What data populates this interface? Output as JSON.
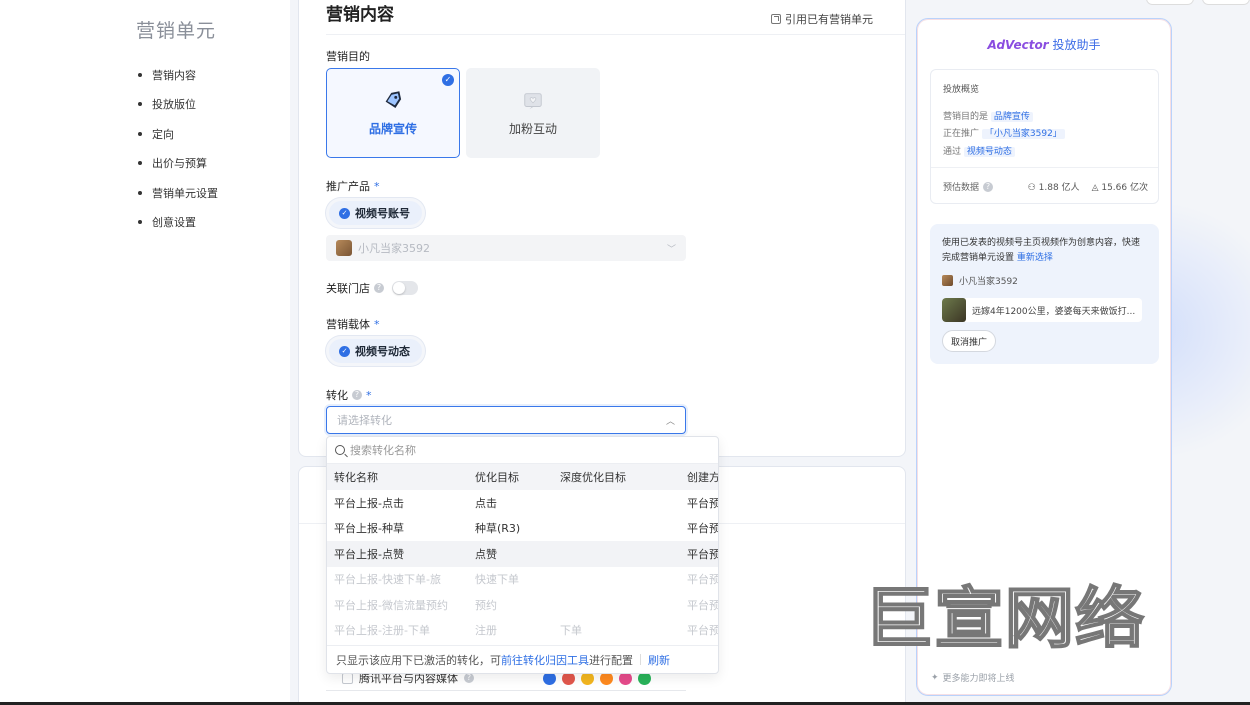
{
  "nav": {
    "title": "营销单元",
    "items": [
      "营销内容",
      "投放版位",
      "定向",
      "出价与预算",
      "营销单元设置",
      "创意设置"
    ]
  },
  "main": {
    "section_title": "营销内容",
    "quote_link": "引用已有营销单元",
    "goal_label": "营销目的",
    "goals": [
      {
        "label": "品牌宣传",
        "icon": "tag-icon",
        "selected": true
      },
      {
        "label": "加粉互动",
        "icon": "message-heart-icon",
        "selected": false
      }
    ],
    "product_label": "推广产品",
    "product_pill": "视频号账号",
    "account_select": "小凡当家3592",
    "store_label": "关联门店",
    "carrier_label": "营销载体",
    "carrier_pill": "视频号动态",
    "conversion_label": "转化",
    "conversion_placeholder": "请选择转化",
    "required_mark": "*"
  },
  "dropdown": {
    "search_placeholder": "搜索转化名称",
    "columns": [
      "转化名称",
      "优化目标",
      "深度优化目标",
      "创建方"
    ],
    "rows": [
      {
        "name": "平台上报-点击",
        "goal": "点击",
        "deep": "",
        "creator": "平台预",
        "state": "normal"
      },
      {
        "name": "平台上报-种草",
        "goal": "种草(R3)",
        "deep": "",
        "creator": "平台预",
        "state": "normal"
      },
      {
        "name": "平台上报-点赞",
        "goal": "点赞",
        "deep": "",
        "creator": "平台预",
        "state": "hover"
      },
      {
        "name": "平台上报-快速下单-旅",
        "goal": "快速下单",
        "deep": "",
        "creator": "平台预",
        "state": "disabled"
      },
      {
        "name": "平台上报-微信流量预约",
        "goal": "预约",
        "deep": "",
        "creator": "平台预",
        "state": "disabled"
      },
      {
        "name": "平台上报-注册-下单",
        "goal": "注册",
        "deep": "下单",
        "creator": "平台预",
        "state": "disabled"
      }
    ],
    "footer_text": "只显示该应用下已激活的转化，可",
    "footer_link": "前往转化归因工具",
    "footer_suffix": "进行配置",
    "footer_refresh": "刷新"
  },
  "below": {
    "media_label": "腾讯平台与内容媒体",
    "media_colors": [
      "#2f6fe4",
      "#e2574c",
      "#f3b61f",
      "#ff8a1f",
      "#e64b8b",
      "#29b35a"
    ]
  },
  "assistant": {
    "brand": "AdVector",
    "title": "投放助手",
    "overview_title": "投放概览",
    "goal_prefix": "营销目的是",
    "goal_value": "品牌宣传",
    "promo_prefix": "正在推广",
    "promo_value": "「小凡当家3592」",
    "via_prefix": "通过",
    "via_value": "视频号动态",
    "estimate_label": "预估数据",
    "stat_users": "1.88 亿人",
    "stat_exposure": "15.66 亿次",
    "suggest_text": "使用已发表的视频号主页视频作为创意内容，快速完成营销单元设置",
    "suggest_link": "重新选择",
    "account_name": "小凡当家3592",
    "video_title": "远嫁4年1200公里，婆婆每天来做饭打...",
    "cancel_button": "取消推广",
    "more_text": "更多能力即将上线"
  },
  "watermark": "巨宣网络",
  "colors": {
    "accent": "#2f6fe4",
    "brand_purple": "#8a4de0"
  }
}
